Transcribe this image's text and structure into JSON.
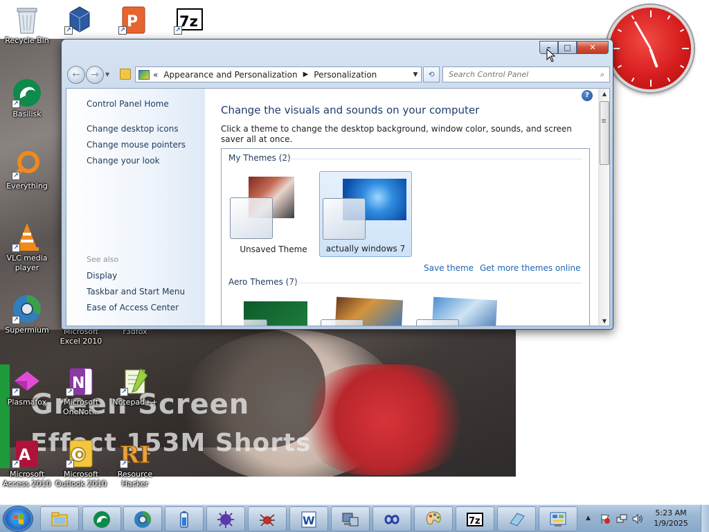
{
  "video_overlay": {
    "line1": "Green Screen",
    "line2": "Effect 153M Shorts"
  },
  "desktop_icons": [
    {
      "label": "Recycle Bin"
    },
    {
      "label": "Basilisk"
    },
    {
      "label": "Everything"
    },
    {
      "label": "VLC media player"
    },
    {
      "label": "Supermium"
    },
    {
      "label": "Plasmafox"
    },
    {
      "label": "Microsoft Access 2010"
    },
    {
      "label": "Microsoft Excel 2010"
    },
    {
      "label": "Microsoft OneNot..."
    },
    {
      "label": "Microsoft Outlook 2010"
    },
    {
      "label": "r3dfox"
    },
    {
      "label": "Notepad++"
    },
    {
      "label": "Resource Hacker"
    }
  ],
  "window": {
    "address": {
      "prefix": "«",
      "crumbs": [
        "Appearance and Personalization",
        "Personalization"
      ]
    },
    "search": {
      "placeholder": "Search Control Panel"
    },
    "left_pane": {
      "home": "Control Panel Home",
      "links": [
        "Change desktop icons",
        "Change mouse pointers",
        "Change your look"
      ],
      "see_also_title": "See also",
      "see_also": [
        "Display",
        "Taskbar and Start Menu",
        "Ease of Access Center"
      ]
    },
    "main": {
      "title": "Change the visuals and sounds on your computer",
      "description": "Click a theme to change the desktop background, window color, sounds, and screen saver all at once.",
      "my_themes_header": "My Themes (2)",
      "my_themes": [
        {
          "name": "Unsaved Theme",
          "selected": false
        },
        {
          "name": "actually windows 7",
          "selected": true
        }
      ],
      "save_theme": "Save theme",
      "get_more": "Get more themes online",
      "aero_header": "Aero Themes (7)"
    }
  },
  "taskbar": {
    "time": "5:23 AM",
    "date": "1/9/2025",
    "buttons": [
      "explorer",
      "basilisk",
      "supermium",
      "battery",
      "virus",
      "spider",
      "word",
      "control",
      "infinity",
      "paint",
      "7zip",
      "edit",
      "control-panel"
    ]
  },
  "colors": {
    "accent": "#1e64b4",
    "title_blue": "#1d3c6e",
    "clock_red": "#d61d1d"
  }
}
